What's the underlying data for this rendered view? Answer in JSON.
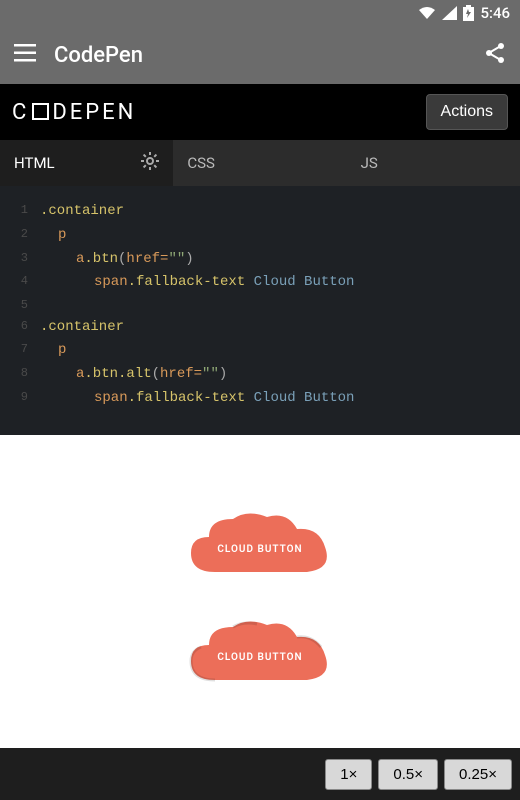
{
  "status": {
    "time": "5:46"
  },
  "appbar": {
    "title": "CodePen"
  },
  "logo": {
    "text_left": "C",
    "text_right": "DEPEN",
    "actions": "Actions"
  },
  "tabs": {
    "html": "HTML",
    "css": "CSS",
    "js": "JS"
  },
  "code": {
    "l1": {
      "n": "1",
      "tag": ".container"
    },
    "l2": {
      "n": "2",
      "tag": "p"
    },
    "l3": {
      "n": "3",
      "a": "a",
      "cls": ".btn",
      "paren_open": "(",
      "attr": "href=",
      "val": "\"\"",
      "paren_close": ")"
    },
    "l4": {
      "n": "4",
      "span": "span",
      "cls": ".fallback-text",
      "txt": " Cloud Button"
    },
    "l5": {
      "n": "5"
    },
    "l6": {
      "n": "6",
      "tag": ".container"
    },
    "l7": {
      "n": "7",
      "tag": "p"
    },
    "l8": {
      "n": "8",
      "a": "a",
      "cls": ".btn.alt",
      "paren_open": "(",
      "attr": "href=",
      "val": "\"\"",
      "paren_close": ")"
    },
    "l9": {
      "n": "9",
      "span": "span",
      "cls": ".fallback-text",
      "txt": " Cloud Button"
    }
  },
  "preview": {
    "label1": "CLOUD BUTTON",
    "label2": "CLOUD BUTTON",
    "color": "#ec6e59"
  },
  "zoom": {
    "z1": "1×",
    "z05": "0.5×",
    "z025": "0.25×"
  }
}
